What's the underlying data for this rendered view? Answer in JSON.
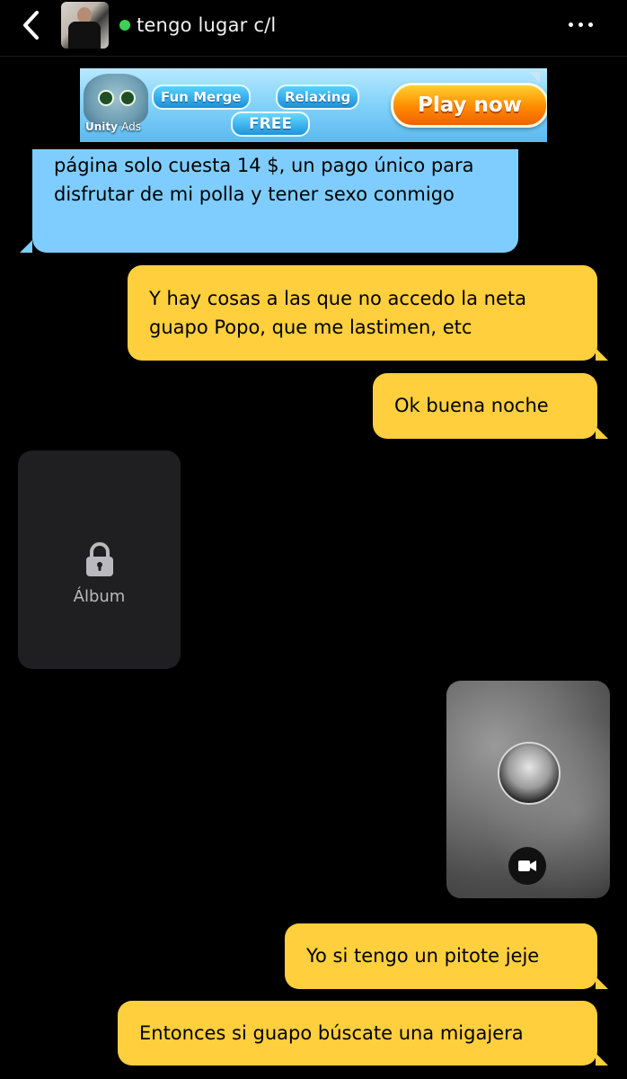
{
  "header": {
    "title": "tengo lugar c/l",
    "online": true,
    "back_icon": "chevron-left-icon",
    "more_icon": "more-dots-icon"
  },
  "ad": {
    "badge_one": "Fun Merge",
    "badge_two": "Relaxing",
    "free_label": "FREE",
    "cta_label": "Play now",
    "sponsor_label": "Unity",
    "sponsor_sub": "Ads"
  },
  "messages": [
    {
      "direction": "in",
      "text": "página solo cuesta 14 $, un pago único para disfrutar de mi polla y tener sexo conmigo"
    },
    {
      "direction": "out",
      "text": "Y hay cosas a las que no accedo la neta guapo Popo, que me lastimen, etc"
    },
    {
      "direction": "out",
      "text": "Ok buena noche"
    },
    {
      "direction": "out",
      "text": "Yo si tengo un pitote jeje"
    },
    {
      "direction": "out",
      "text": "Entonces si guapo búscate una migajera"
    }
  ],
  "album": {
    "label": "Álbum",
    "icon": "lock-icon"
  },
  "video": {
    "icon": "video-camera-icon"
  },
  "colors": {
    "incoming_bubble": "#7fcdff",
    "outgoing_bubble": "#ffcf3d",
    "background": "#000000",
    "online": "#3ecf59"
  }
}
